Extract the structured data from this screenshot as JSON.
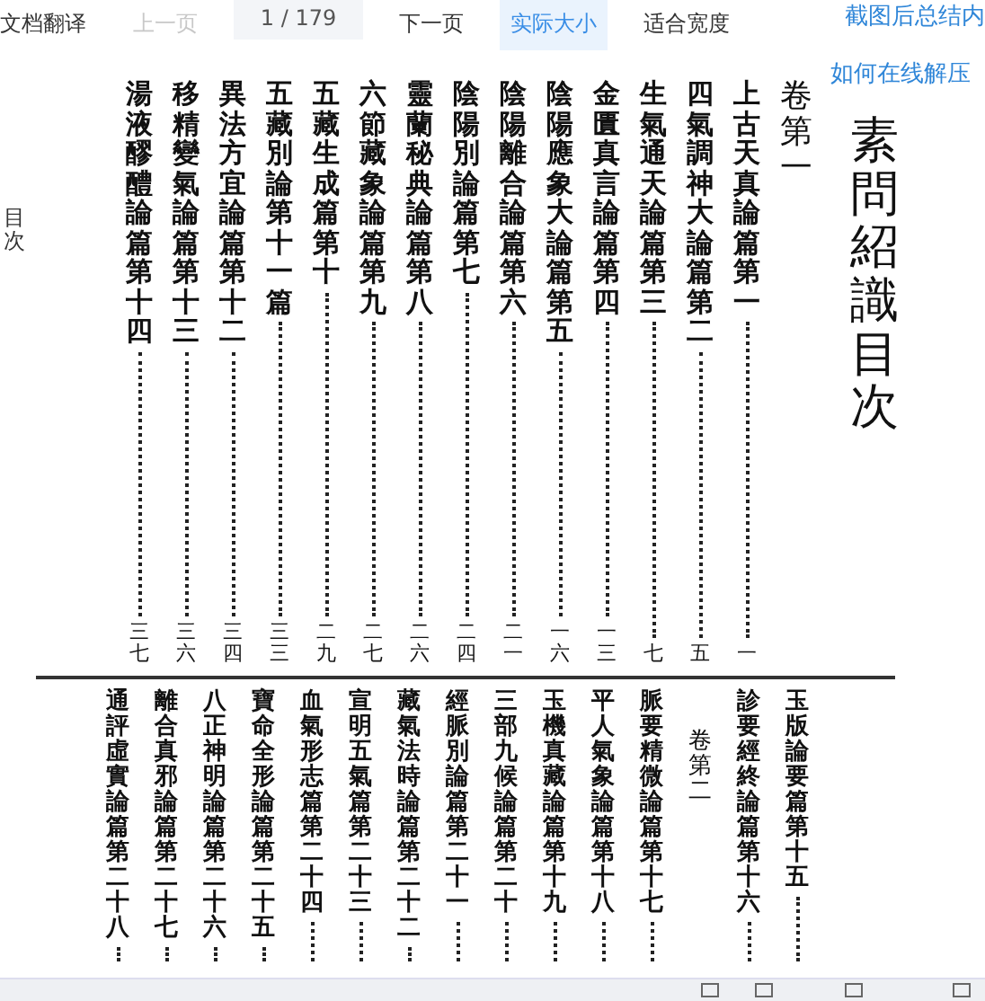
{
  "toolbar": {
    "items": [
      {
        "kind": "button",
        "label": "文档翻译",
        "disabled": false,
        "selected": false
      },
      {
        "kind": "button",
        "label": "上一页",
        "disabled": true,
        "selected": false
      },
      {
        "kind": "field",
        "value": "1 / 179"
      },
      {
        "kind": "button",
        "label": "下一页",
        "disabled": false,
        "selected": false
      },
      {
        "kind": "button",
        "label": "实际大小",
        "disabled": false,
        "selected": true
      },
      {
        "kind": "button",
        "label": "适合宽度",
        "disabled": false,
        "selected": false
      }
    ],
    "summary_link": "截图后总结内"
  },
  "help_link": "如何在线解压",
  "page": {
    "margin_text": "目次",
    "top_entries": [
      {
        "kind": "entry",
        "text": "湯液醪醴論篇第十四",
        "page": "三七"
      },
      {
        "kind": "entry",
        "text": "移精變氣論篇第十三",
        "page": "三六"
      },
      {
        "kind": "entry",
        "text": "異法方宜論篇第十二",
        "page": "三四"
      },
      {
        "kind": "entry",
        "text": "五藏別論第十一篇",
        "page": "三三"
      },
      {
        "kind": "entry",
        "text": "五藏生成篇第十",
        "page": "二九"
      },
      {
        "kind": "entry",
        "text": "六節藏象論篇第九",
        "page": "二七"
      },
      {
        "kind": "entry",
        "text": "靈蘭秘典論篇第八",
        "page": "二六"
      },
      {
        "kind": "entry",
        "text": "陰陽別論篇第七",
        "page": "二四"
      },
      {
        "kind": "entry",
        "text": "陰陽離合論篇第六",
        "page": "二一"
      },
      {
        "kind": "entry",
        "text": "陰陽應象大論篇第五",
        "page": "一六"
      },
      {
        "kind": "entry",
        "text": "金匱真言論篇第四",
        "page": "一三"
      },
      {
        "kind": "entry",
        "text": "生氣通天論篇第三",
        "page": "七"
      },
      {
        "kind": "entry",
        "text": "四氣調神大論篇第二",
        "page": "五"
      },
      {
        "kind": "entry",
        "text": "上古天真論篇第一",
        "page": "一"
      },
      {
        "kind": "heading",
        "text": "卷第一"
      }
    ],
    "title": "素問紹識目次",
    "bottom_entries": [
      {
        "kind": "entry",
        "text": "通評虛實論篇第二十八"
      },
      {
        "kind": "entry",
        "text": "離合真邪論篇第二十七"
      },
      {
        "kind": "entry",
        "text": "八正神明論篇第二十六"
      },
      {
        "kind": "entry",
        "text": "寶命全形論篇第二十五"
      },
      {
        "kind": "entry",
        "text": "血氣形志篇第二十四"
      },
      {
        "kind": "entry",
        "text": "宣明五氣篇第二十三"
      },
      {
        "kind": "entry",
        "text": "藏氣法時論篇第二十二"
      },
      {
        "kind": "entry",
        "text": "經脈別論篇第二十一"
      },
      {
        "kind": "entry",
        "text": "三部九候論篇第二十"
      },
      {
        "kind": "entry",
        "text": "玉機真藏論篇第十九"
      },
      {
        "kind": "entry",
        "text": "平人氣象論篇第十八"
      },
      {
        "kind": "entry",
        "text": "脈要精微論篇第十七"
      },
      {
        "kind": "heading",
        "text": "卷第二"
      },
      {
        "kind": "entry",
        "text": "診要經終論篇第十六"
      },
      {
        "kind": "entry",
        "text": "玉版論要篇第十五"
      }
    ]
  }
}
